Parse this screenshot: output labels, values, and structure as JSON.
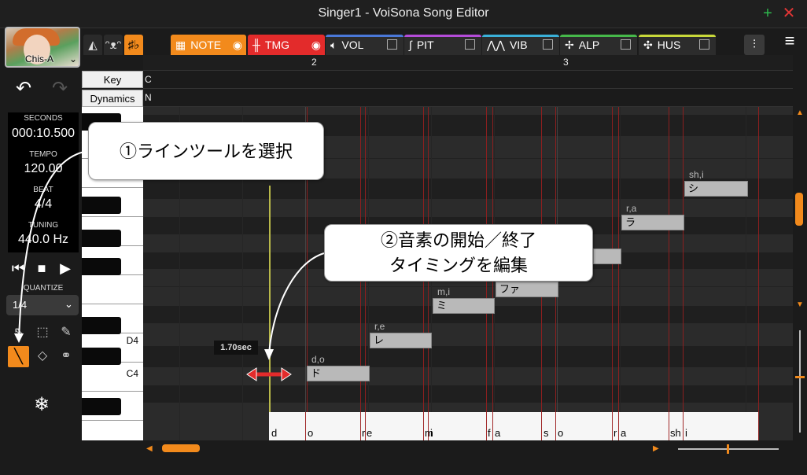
{
  "window": {
    "title": "Singer1 - VoiSona Song Editor",
    "min_icon": "plus-icon",
    "close_icon": "x-icon"
  },
  "singer": {
    "name": "Chis-A"
  },
  "toolbar": {
    "tabs": [
      {
        "label": "NOTE",
        "color": "#f28a1c",
        "indicator": "eye"
      },
      {
        "label": "TMG",
        "color": "#e32b2b",
        "indicator": "eye"
      },
      {
        "label": "VOL",
        "color": "#4a78d8",
        "indicator": "checkbox"
      },
      {
        "label": "PIT",
        "color": "#b44cd8",
        "indicator": "checkbox"
      },
      {
        "label": "VIB",
        "color": "#3ab0d8",
        "indicator": "checkbox"
      },
      {
        "label": "ALP",
        "color": "#46b84a",
        "indicator": "checkbox"
      },
      {
        "label": "HUS",
        "color": "#c8d83a",
        "indicator": "checkbox"
      }
    ]
  },
  "transport": {
    "seconds_label": "SECONDS",
    "seconds": "000:10.500",
    "tempo_label": "TEMPO",
    "tempo": "120.00",
    "beat_label": "BEAT",
    "beat": "4/4",
    "tuning_label": "TUNING",
    "tuning": "440.0 Hz"
  },
  "quantize": {
    "label": "QUANTIZE",
    "value": "1/4"
  },
  "header": {
    "key_label": "Key",
    "key_value": "C",
    "dynamics_label": "Dynamics",
    "dynamics_value": "N",
    "bars": [
      "2",
      "3"
    ]
  },
  "keyboard": {
    "labels": [
      "D4",
      "C4"
    ]
  },
  "notes": [
    {
      "lyric": "ド",
      "phoneme": "d,o"
    },
    {
      "lyric": "レ",
      "phoneme": "r,e"
    },
    {
      "lyric": "ミ",
      "phoneme": "m,i"
    },
    {
      "lyric": "ファ",
      "phoneme": ""
    },
    {
      "lyric": "",
      "phoneme": ""
    },
    {
      "lyric": "ラ",
      "phoneme": "r,a"
    },
    {
      "lyric": "シ",
      "phoneme": "sh,i"
    }
  ],
  "phoneme_track": [
    "d",
    "o",
    "re",
    "mi",
    "fa",
    "so",
    "ra",
    "shi"
  ],
  "phoneme_letters": [
    "d",
    "o",
    "r",
    "e",
    "m",
    "i",
    "f",
    "a",
    "s",
    "o",
    "r",
    "a",
    "sh",
    "i"
  ],
  "annotations": {
    "callout1": "①ラインツールを選択",
    "callout2_line1": "②音素の開始／終了",
    "callout2_line2": "タイミングを編集",
    "duration": "1.70sec"
  }
}
